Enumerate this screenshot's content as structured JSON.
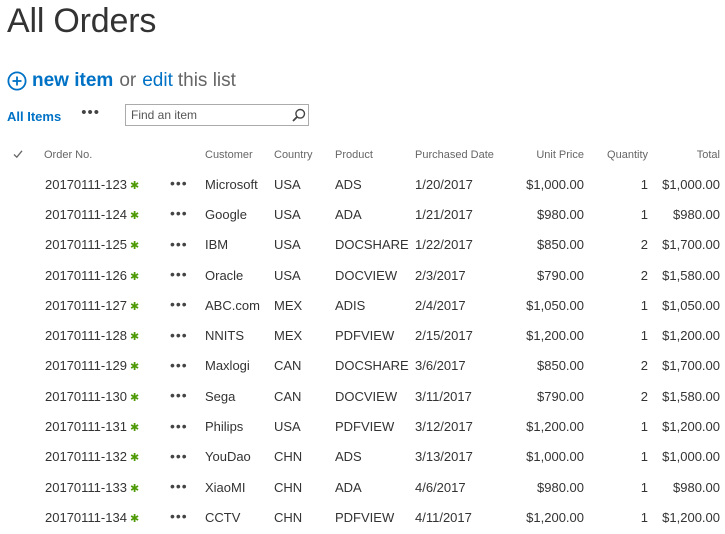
{
  "page": {
    "title": "All Orders"
  },
  "actions": {
    "new_item": "new item",
    "or": "or",
    "edit": "edit",
    "this_list": "this list"
  },
  "views": {
    "current": "All Items",
    "more": "•••"
  },
  "search": {
    "placeholder": "Find an item",
    "value": ""
  },
  "icons": {
    "add": "plus-circle-icon",
    "search": "search-icon",
    "select_all": "checkmark-icon",
    "new": "new-item-icon",
    "more": "ellipsis-icon"
  },
  "colors": {
    "link": "#0072c6",
    "new_badge": "#4e9a06"
  },
  "table": {
    "columns": [
      "Order No.",
      "Customer",
      "Country",
      "Product",
      "Purchased Date",
      "Unit Price",
      "Quantity",
      "Total"
    ],
    "rows": [
      {
        "order": "20170111-123",
        "customer": "Microsoft",
        "country": "USA",
        "product": "ADS",
        "date": "1/20/2017",
        "price": "$1,000.00",
        "qty": "1",
        "total": "$1,000.00"
      },
      {
        "order": "20170111-124",
        "customer": "Google",
        "country": "USA",
        "product": "ADA",
        "date": "1/21/2017",
        "price": "$980.00",
        "qty": "1",
        "total": "$980.00"
      },
      {
        "order": "20170111-125",
        "customer": "IBM",
        "country": "USA",
        "product": "DOCSHARE",
        "date": "1/22/2017",
        "price": "$850.00",
        "qty": "2",
        "total": "$1,700.00"
      },
      {
        "order": "20170111-126",
        "customer": "Oracle",
        "country": "USA",
        "product": "DOCVIEW",
        "date": "2/3/2017",
        "price": "$790.00",
        "qty": "2",
        "total": "$1,580.00"
      },
      {
        "order": "20170111-127",
        "customer": "ABC.com",
        "country": "MEX",
        "product": "ADIS",
        "date": "2/4/2017",
        "price": "$1,050.00",
        "qty": "1",
        "total": "$1,050.00"
      },
      {
        "order": "20170111-128",
        "customer": "NNITS",
        "country": "MEX",
        "product": "PDFVIEW",
        "date": "2/15/2017",
        "price": "$1,200.00",
        "qty": "1",
        "total": "$1,200.00"
      },
      {
        "order": "20170111-129",
        "customer": "Maxlogi",
        "country": "CAN",
        "product": "DOCSHARE",
        "date": "3/6/2017",
        "price": "$850.00",
        "qty": "2",
        "total": "$1,700.00"
      },
      {
        "order": "20170111-130",
        "customer": "Sega",
        "country": "CAN",
        "product": "DOCVIEW",
        "date": "3/11/2017",
        "price": "$790.00",
        "qty": "2",
        "total": "$1,580.00"
      },
      {
        "order": "20170111-131",
        "customer": "Philips",
        "country": "USA",
        "product": "PDFVIEW",
        "date": "3/12/2017",
        "price": "$1,200.00",
        "qty": "1",
        "total": "$1,200.00"
      },
      {
        "order": "20170111-132",
        "customer": "YouDao",
        "country": "CHN",
        "product": "ADS",
        "date": "3/13/2017",
        "price": "$1,000.00",
        "qty": "1",
        "total": "$1,000.00"
      },
      {
        "order": "20170111-133",
        "customer": "XiaoMI",
        "country": "CHN",
        "product": "ADA",
        "date": "4/6/2017",
        "price": "$980.00",
        "qty": "1",
        "total": "$980.00"
      },
      {
        "order": "20170111-134",
        "customer": "CCTV",
        "country": "CHN",
        "product": "PDFVIEW",
        "date": "4/11/2017",
        "price": "$1,200.00",
        "qty": "1",
        "total": "$1,200.00"
      }
    ]
  }
}
